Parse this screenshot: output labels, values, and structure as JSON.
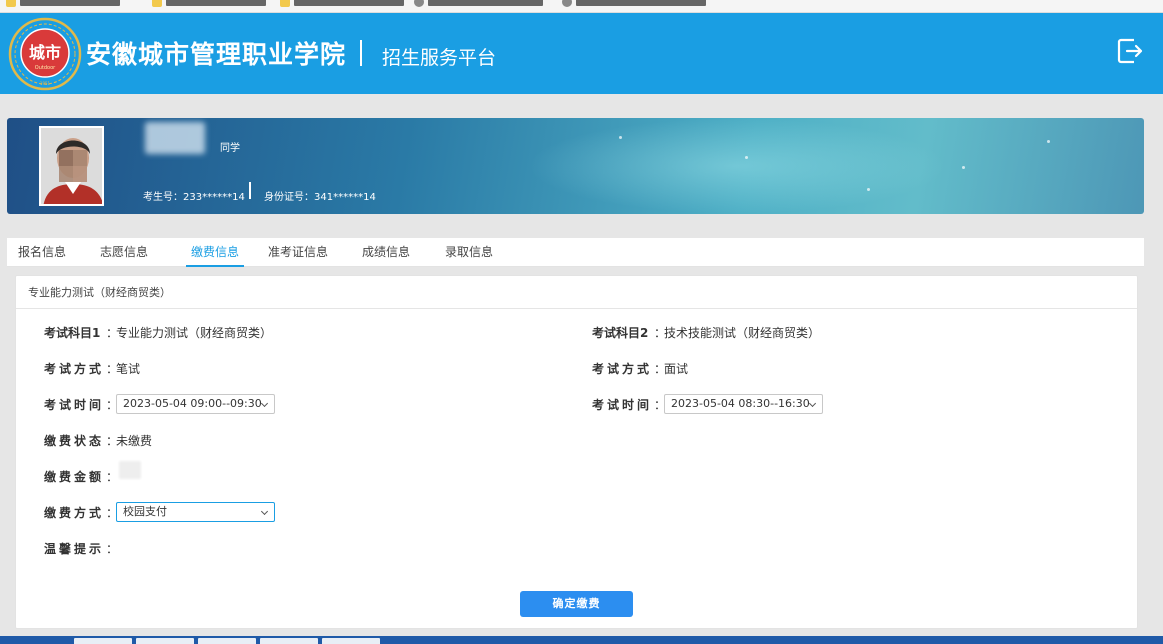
{
  "header": {
    "school_name": "安徽城市管理职业学院",
    "separator": "|",
    "platform_name": "招生服务平台",
    "logo_text": "城市",
    "logo_subtext": "Outdoor",
    "logo_caption": "1951",
    "exit_icon": "exit-icon"
  },
  "profile": {
    "suffix": "同学",
    "exam_no": "考生号：233******14",
    "id_no": "身份证号：341******14"
  },
  "tabs": [
    {
      "label": "报名信息",
      "active": false
    },
    {
      "label": "志愿信息",
      "active": false
    },
    {
      "label": "缴费信息",
      "active": true
    },
    {
      "label": "准考证信息",
      "active": false
    },
    {
      "label": "成绩信息",
      "active": false
    },
    {
      "label": "录取信息",
      "active": false
    }
  ],
  "panel": {
    "title": "专业能力测试（财经商贸类）",
    "left": {
      "subject_label": "考试科目1",
      "subject_value": "专业能力测试（财经商贸类）",
      "method_label": "考试方式",
      "method_value": "笔试",
      "time_label": "考试时间",
      "time_value": "2023-05-04 09:00--09:30",
      "status_label": "缴费状态",
      "status_value": "未缴费",
      "amount_label": "缴费金额",
      "pay_method_label": "缴费方式",
      "pay_method_value": "校园支付",
      "tips_label": "温馨提示"
    },
    "right": {
      "subject_label": "考试科目2",
      "subject_value": "技术技能测试（财经商贸类）",
      "method_label": "考试方式",
      "method_value": "面试",
      "time_label": "考试时间",
      "time_value": "2023-05-04 08:30--16:30"
    },
    "colon": "：",
    "confirm_button": "确定缴费"
  },
  "colors": {
    "header_bg": "#1a9ee3",
    "accent": "#2c8ef0",
    "tab_active": "#1a9ee3"
  }
}
